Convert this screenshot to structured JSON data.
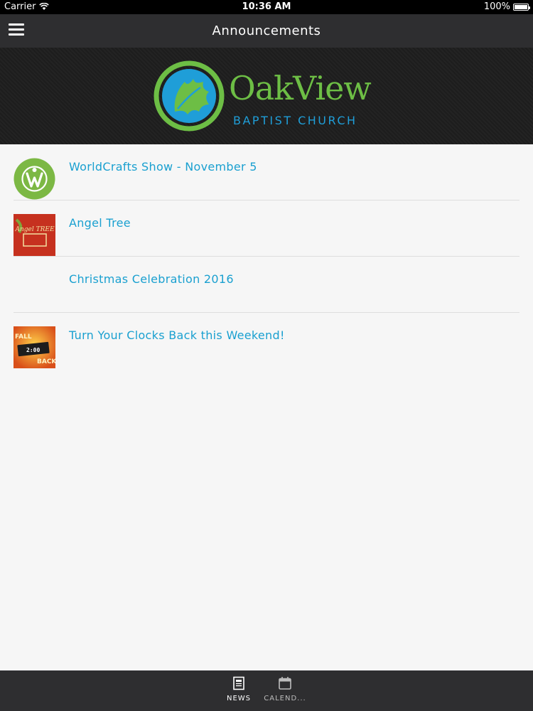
{
  "status_bar": {
    "carrier": "Carrier",
    "time": "10:36 AM",
    "battery": "100%"
  },
  "nav": {
    "title": "Announcements"
  },
  "banner": {
    "logo_title": "OakView",
    "logo_subtitle": "BAPTIST CHURCH"
  },
  "announcements": [
    {
      "title": "WorldCrafts Show - November 5",
      "icon": "worldcrafts-logo-icon"
    },
    {
      "title": "Angel Tree",
      "icon": "angel-tree-icon",
      "thumb_text": "Angel TREE"
    },
    {
      "title": "Christmas Celebration 2016",
      "icon": ""
    },
    {
      "title": "Turn Your Clocks Back this Weekend!",
      "icon": "fall-back-clock-icon",
      "thumb_text_1": "FALL",
      "thumb_text_2": "BACK",
      "thumb_clock": "2:00"
    }
  ],
  "tabs": [
    {
      "label": "NEWS",
      "icon": "news-icon",
      "active": true
    },
    {
      "label": "CALEND...",
      "icon": "calendar-icon",
      "active": false
    }
  ],
  "colors": {
    "accent": "#1aa0d0",
    "brand_green": "#6dbe45",
    "brand_blue": "#1f9ed8",
    "nav_background": "#2e2e30"
  }
}
